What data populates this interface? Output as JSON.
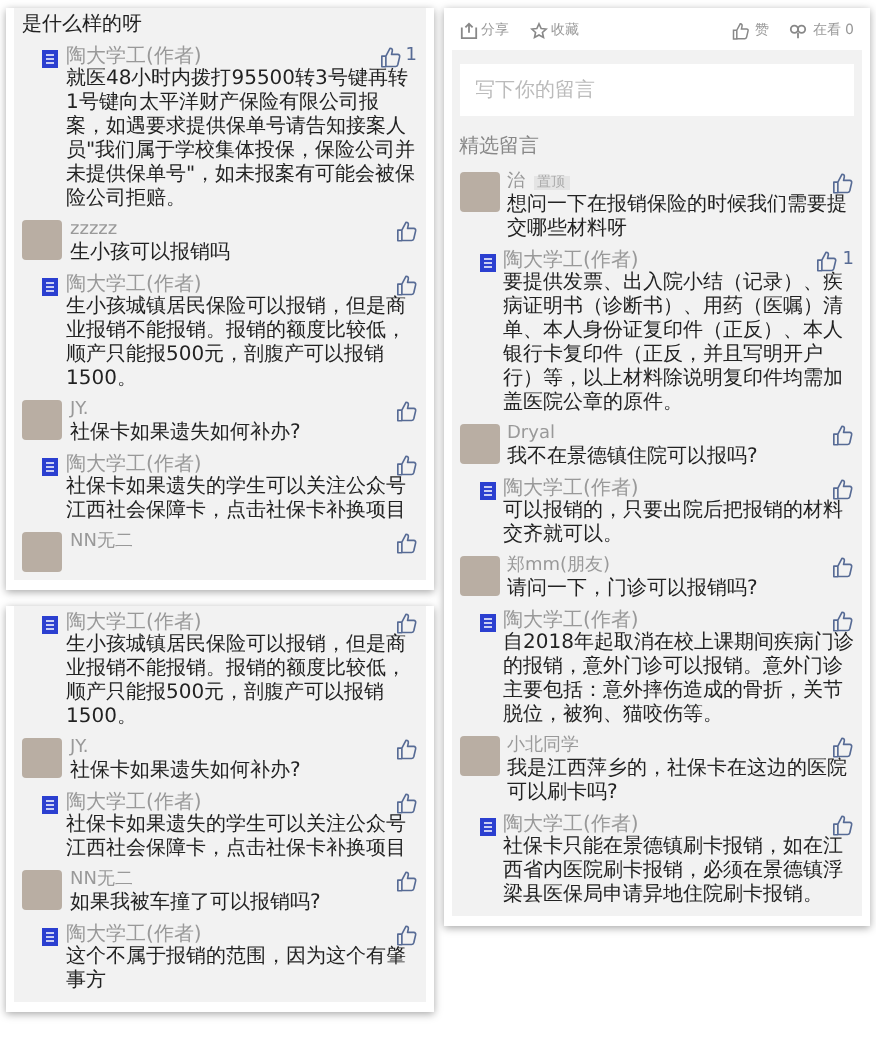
{
  "left_panels": [
    {
      "items": [
        {
          "kind": "fragment",
          "text": "是什么样的呀"
        },
        {
          "kind": "reply",
          "name": "陶大学工(作者)",
          "likes": "1",
          "text": "就医48小时内拨打95500转3号键再转1号键向太平洋财产保险有限公司报案，如遇要求提供保单号请告知接案人员\"我们属于学校集体投保，保险公司并未提供保单号\"，如未报案有可能会被保险公司拒赔。"
        },
        {
          "kind": "comment",
          "name": "zzzzz",
          "text": "生小孩可以报销吗"
        },
        {
          "kind": "reply",
          "name": "陶大学工(作者)",
          "text": "生小孩城镇居民保险可以报销，但是商业报销不能报销。报销的额度比较低，顺产只能报500元，剖腹产可以报销1500。"
        },
        {
          "kind": "comment",
          "name": "JY.",
          "text": "社保卡如果遗失如何补办?"
        },
        {
          "kind": "reply",
          "name": "陶大学工(作者)",
          "text": "社保卡如果遗失的学生可以关注公众号江西社会保障卡，点击社保卡补换项目"
        },
        {
          "kind": "comment",
          "name": "NN无二"
        }
      ]
    },
    {
      "items": [
        {
          "kind": "reply",
          "name": "陶大学工(作者)",
          "text": "生小孩城镇居民保险可以报销，但是商业报销不能报销。报销的额度比较低，顺产只能报500元，剖腹产可以报销1500。"
        },
        {
          "kind": "comment",
          "name": "JY.",
          "text": "社保卡如果遗失如何补办?"
        },
        {
          "kind": "reply",
          "name": "陶大学工(作者)",
          "text": "社保卡如果遗失的学生可以关注公众号江西社会保障卡，点击社保卡补换项目"
        },
        {
          "kind": "comment",
          "name": "NN无二",
          "text": "如果我被车撞了可以报销吗?"
        },
        {
          "kind": "reply",
          "name": "陶大学工(作者)",
          "text": "这个不属于报销的范围，因为这个有肇事方"
        }
      ]
    }
  ],
  "right_panel": {
    "toolbar": [
      "分享",
      "收藏",
      "赞",
      "在看 0"
    ],
    "comment_box": {
      "placeholder": "写下你的留言"
    },
    "section_label": "精选留言",
    "items": [
      {
        "kind": "comment",
        "name": "治",
        "tag": "置顶",
        "text": "想问一下在报销保险的时候我们需要提交哪些材料呀"
      },
      {
        "kind": "reply",
        "name": "陶大学工(作者)",
        "likes": "1",
        "text": "要提供发票、出入院小结（记录）、疾病证明书（诊断书）、用药（医嘱）清单、本人身份证复印件（正反）、本人银行卡复印件（正反，并且写明开户行）等，以上材料除说明复印件均需加盖医院公章的原件。"
      },
      {
        "kind": "comment",
        "name": "Dryal",
        "text": "我不在景德镇住院可以报吗?"
      },
      {
        "kind": "reply",
        "name": "陶大学工(作者)",
        "text": "可以报销的，只要出院后把报销的材料交齐就可以。"
      },
      {
        "kind": "comment",
        "name": "郑mm(朋友)",
        "text": "请问一下，门诊可以报销吗?"
      },
      {
        "kind": "reply",
        "name": "陶大学工(作者)",
        "text": "自2018年起取消在校上课期间疾病门诊的报销，意外门诊可以报销。意外门诊主要包括：意外摔伤造成的骨折，关节脱位，被狗、猫咬伤等。"
      },
      {
        "kind": "comment",
        "name": "小北同学",
        "text": "我是江西萍乡的，社保卡在这边的医院可以刷卡吗?"
      },
      {
        "kind": "reply",
        "name": "陶大学工(作者)",
        "text": "社保卡只能在景德镇刷卡报销，如在江西省内医院刷卡报销，必须在景德镇浮梁县医保局申请异地住院刷卡报销。"
      }
    ]
  }
}
